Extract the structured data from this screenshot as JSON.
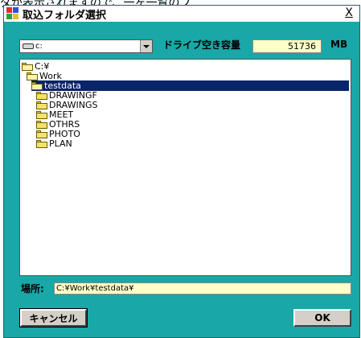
{
  "background_text": "ダが表示されますので、一ヶ一覧のフ",
  "window": {
    "title": "取込フォルダ選択",
    "close_label": "X"
  },
  "drive": {
    "selected": "c:",
    "free_space_label": "ドライブ空き容量",
    "free_space_value": "51736",
    "free_space_unit": "MB"
  },
  "tree": {
    "items": [
      {
        "label": "C:¥",
        "open": true,
        "selected": false
      },
      {
        "label": "Work",
        "open": true,
        "selected": false
      },
      {
        "label": "testdata",
        "open": true,
        "selected": true
      },
      {
        "label": "DRAWINGF",
        "open": false,
        "selected": false
      },
      {
        "label": "DRAWINGS",
        "open": false,
        "selected": false
      },
      {
        "label": "MEET",
        "open": false,
        "selected": false
      },
      {
        "label": "OTHRS",
        "open": false,
        "selected": false
      },
      {
        "label": "PHOTO",
        "open": false,
        "selected": false
      },
      {
        "label": "PLAN",
        "open": false,
        "selected": false
      }
    ]
  },
  "location": {
    "label": "場所:",
    "value": "C:¥Work¥testdata¥"
  },
  "buttons": {
    "cancel_label": "キャンセル",
    "ok_label": "OK"
  },
  "colors": {
    "dialog_bg": "#1aa7a7",
    "selection": "#0a246a",
    "field_bg": "#ffffc8"
  }
}
